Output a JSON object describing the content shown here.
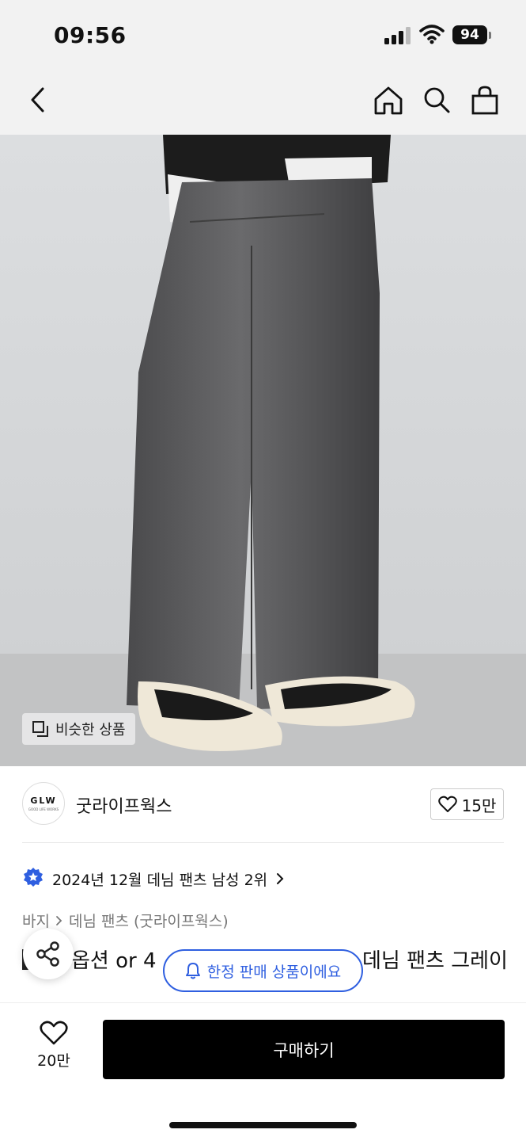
{
  "status_bar": {
    "time": "09:56",
    "battery": "94"
  },
  "nav": {
    "icons": [
      "back-icon",
      "home-icon",
      "search-icon",
      "cart-icon"
    ]
  },
  "hero": {
    "similar_label": "비슷한 상품"
  },
  "brand": {
    "logo_text": "GLW",
    "logo_sub": "GOOD LIFE WORKS",
    "name": "굿라이프웍스",
    "like_count": "15만"
  },
  "ranking": {
    "text": "2024년 12월 데님 팬츠 남성 2위"
  },
  "breadcrumb": {
    "level1": "바지",
    "level2": "데님 팬츠 (굿라이프웍스)"
  },
  "product": {
    "title_left": "옵션 or 4",
    "title_right": "데님 팬츠 그레이"
  },
  "limited_badge": "한정 판매 상품이에요",
  "bottom": {
    "wish_count": "20만",
    "buy_label": "구매하기"
  },
  "colors": {
    "accent_blue": "#2f5fe0",
    "buy_button": "#000000"
  }
}
